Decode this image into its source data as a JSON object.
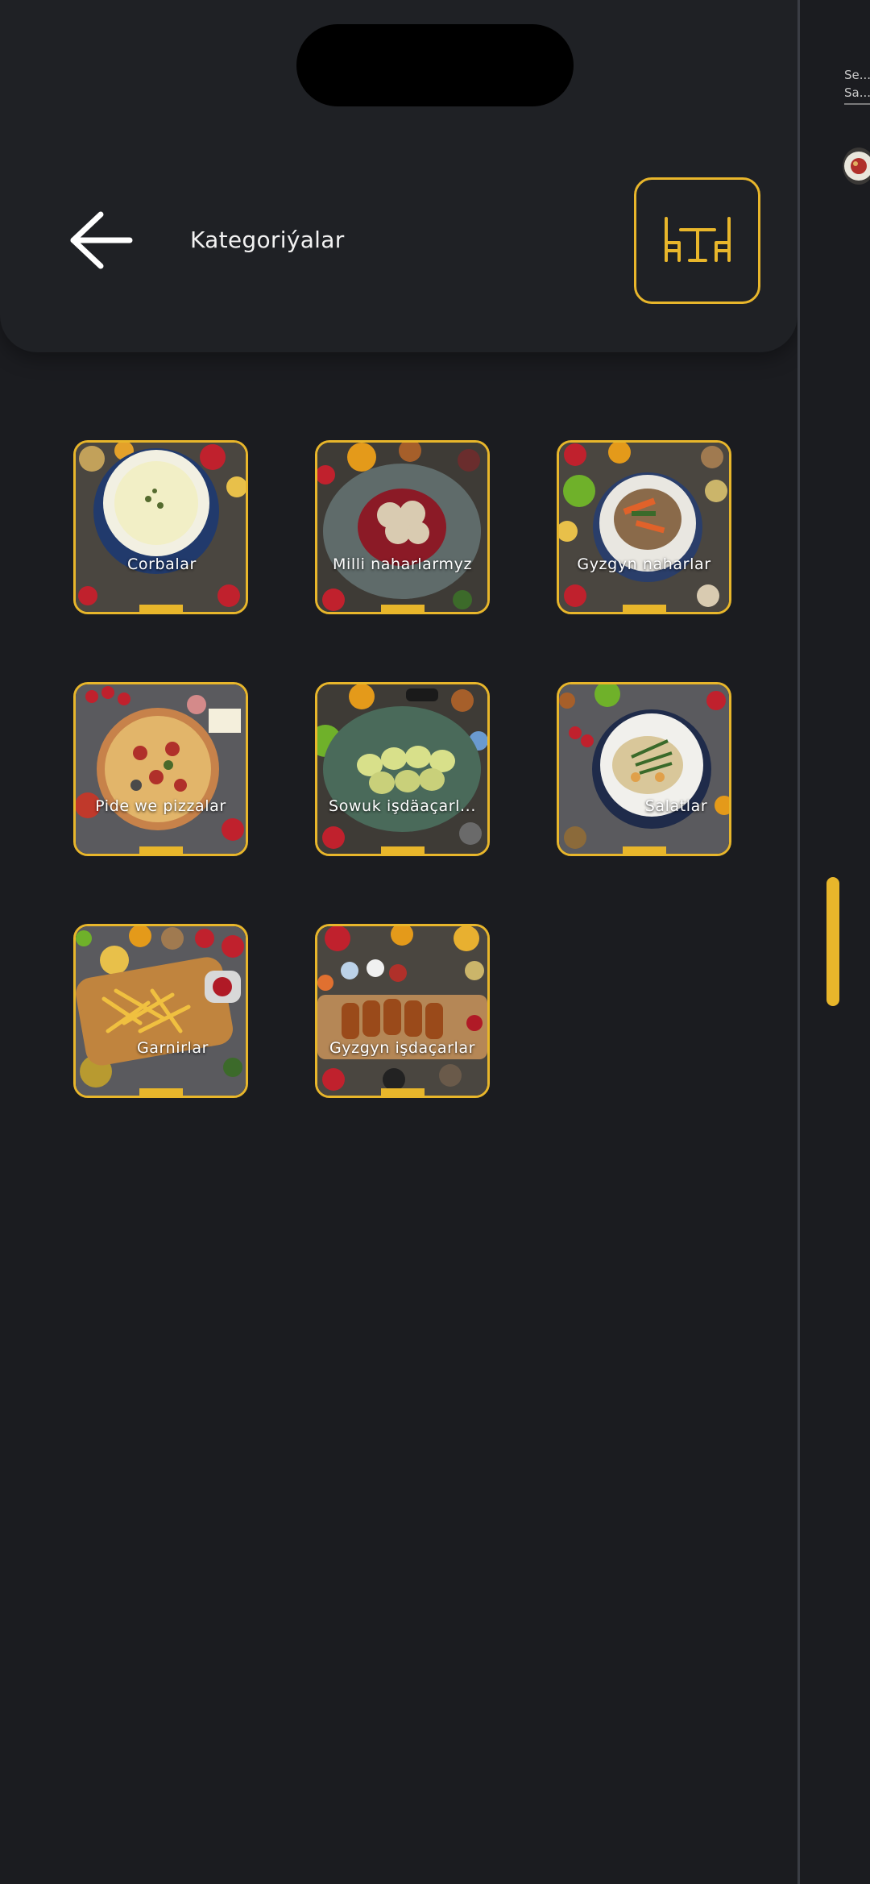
{
  "header": {
    "title": "Kategoriýalar",
    "back_icon": "arrow-left-icon",
    "table_icon": "dining-table-icon"
  },
  "categories": [
    {
      "label": "Corbalar",
      "icon": "soup-bowl"
    },
    {
      "label": "Milli naharlarmyz",
      "icon": "dumplings-plate"
    },
    {
      "label": "Gyzgyn naharlar",
      "icon": "stew-plate"
    },
    {
      "label": "Pide we pizzalar",
      "icon": "pizza"
    },
    {
      "label": "Sowuk işdäaçarl...",
      "icon": "rolls-plate"
    },
    {
      "label": "Salatlar",
      "icon": "salad-plate"
    },
    {
      "label": "Garnirlar",
      "icon": "fries-board"
    },
    {
      "label": "Gyzgyn işdaçarlar",
      "icon": "fried-board"
    }
  ],
  "side_panel": {
    "line1": "Se...",
    "line2": "Sa..."
  },
  "colors": {
    "background": "#1b1c20",
    "header": "#1f2125",
    "accent": "#e8b62b"
  }
}
